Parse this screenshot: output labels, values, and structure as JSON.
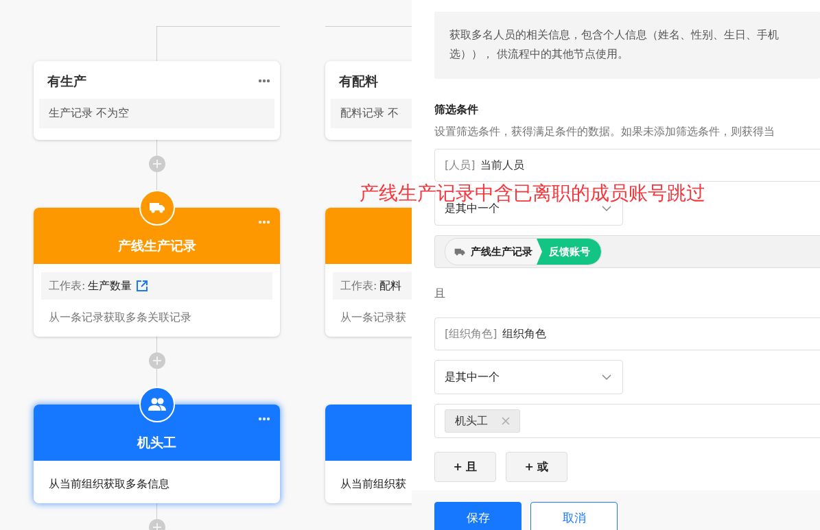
{
  "flow": {
    "branches": [
      {
        "condition": {
          "title": "有生产",
          "field": "生产记录",
          "operator": "不为空"
        },
        "nodes": [
          {
            "kind": "record",
            "title": "产线生产记录",
            "selected": false,
            "sheet_label": "工作表:",
            "sheet": "生产数量",
            "link": true,
            "description": "从一条记录获取多条关联记录"
          },
          {
            "kind": "members",
            "title": "机头工",
            "selected": true,
            "description": "从当前组织获取多条信息"
          }
        ]
      },
      {
        "condition": {
          "title": "有配料",
          "field": "配料记录",
          "operator": "不"
        },
        "nodes": [
          {
            "kind": "record",
            "selected": false,
            "sheet_label": "工作表:",
            "sheet": "配料",
            "link": false,
            "description": "从一条记录获"
          },
          {
            "kind": "members",
            "selected": false,
            "description": "从当前组织获"
          }
        ]
      }
    ]
  },
  "annotation": "产线生产记录中含已离职的成员账号跳过",
  "panel": {
    "description_lines": [
      "获取多名人员的相关信息，包含个人信息（姓名、性别、生日、手机",
      "选））， 供流程中的其他节点使用。"
    ],
    "filter_title": "筛选条件",
    "filter_hint": "设置筛选条件，获得满足条件的数据。如果未添加筛选条件，则获得当",
    "groups": [
      {
        "field_type": "[人员]",
        "field": "当前人员",
        "operator": "是其中一个",
        "value": {
          "kind": "reference",
          "source": "产线生产记录",
          "field": "反馈账号"
        }
      },
      {
        "joiner": "且",
        "field_type": "[组织角色]",
        "field": "组织角色",
        "operator": "是其中一个",
        "value": {
          "kind": "tags",
          "tags": [
            "机头工"
          ]
        }
      }
    ],
    "add_buttons": [
      "+ 且",
      "+ 或"
    ],
    "save": "保存",
    "cancel": "取消"
  }
}
